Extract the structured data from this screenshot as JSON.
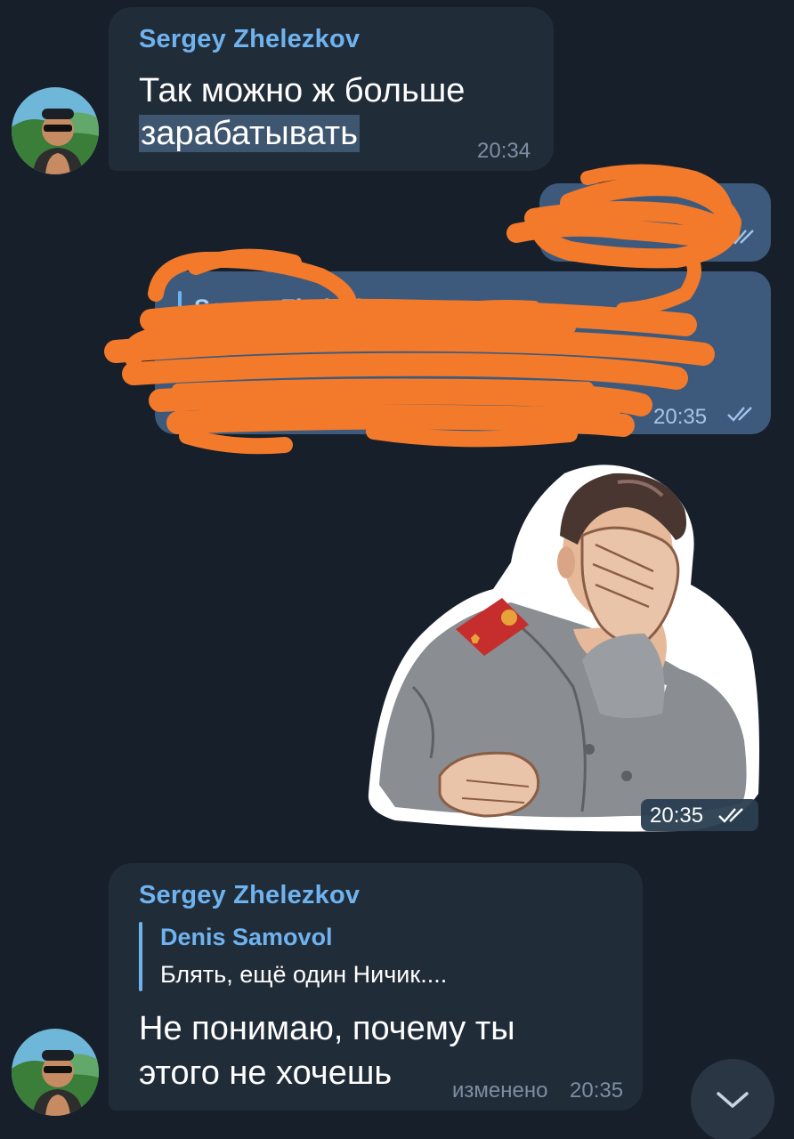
{
  "messages": {
    "msg1": {
      "sender": "Sergey Zhelezkov",
      "text_line1": "Так можно ж больше",
      "text_line2": "зарабатывать",
      "time": "20:34"
    },
    "msg2": {
      "status": "read"
    },
    "msg3": {
      "reply_sender_partial": "Sergey Zhelezkov",
      "time": "20:35"
    },
    "sticker": {
      "description": "facepalm sticker",
      "time": "20:35"
    },
    "msg4": {
      "sender": "Sergey Zhelezkov",
      "reply_name": "Denis Samovol",
      "reply_text": "Блять, ещё один Ничик....",
      "text_line1": "Не понимаю, почему ты",
      "text_line2": "этого не хочешь",
      "edited_label": "изменено",
      "time": "20:35"
    }
  },
  "colors": {
    "background": "#171f2a",
    "incoming_bubble": "#212c39",
    "outgoing_bubble": "#3d5a7d",
    "accent": "#6fb3ee",
    "scribble": "#f47a2b"
  },
  "icons": {
    "read_checks": "double-check-icon",
    "scroll_down": "chevron-down-icon"
  }
}
